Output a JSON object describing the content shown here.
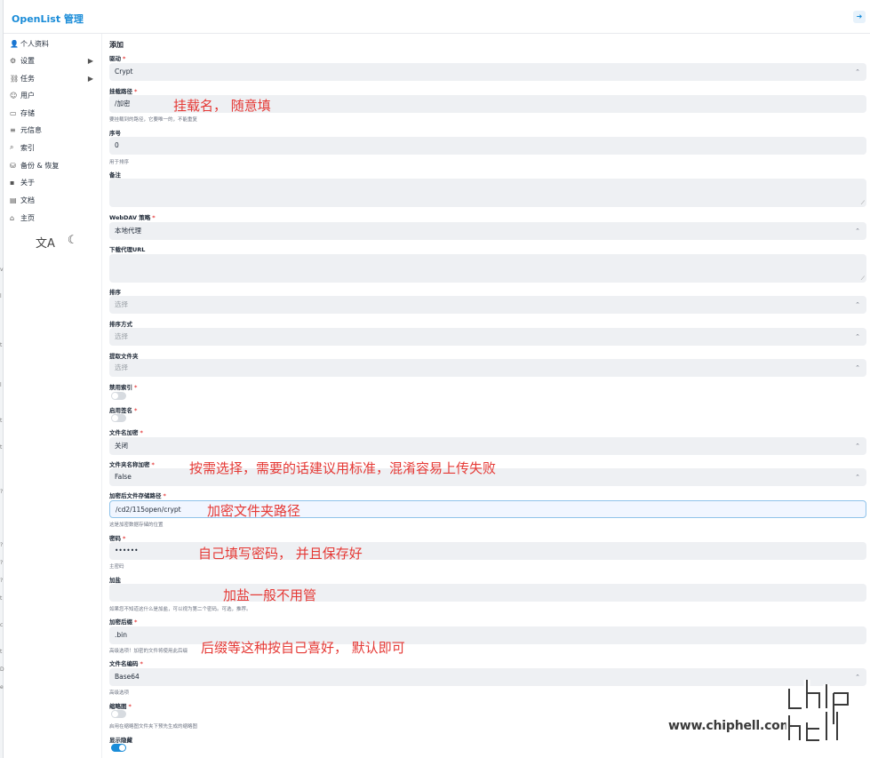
{
  "header": {
    "brand": "OpenList 管理"
  },
  "sidebar": {
    "items": [
      {
        "label": "个人资料",
        "icon": "user-circle-icon",
        "glyph": "👤"
      },
      {
        "label": "设置",
        "icon": "gear-icon",
        "glyph": "⚙",
        "arrow": "▶"
      },
      {
        "label": "任务",
        "icon": "task-icon",
        "glyph": "⛓",
        "arrow": "▶"
      },
      {
        "label": "用户",
        "icon": "user-icon",
        "glyph": "☺"
      },
      {
        "label": "存储",
        "icon": "storage-icon",
        "glyph": "▭"
      },
      {
        "label": "元信息",
        "icon": "meta-icon",
        "glyph": "≡"
      },
      {
        "label": "索引",
        "icon": "search-icon",
        "glyph": "⌕"
      },
      {
        "label": "备份 & 恢复",
        "icon": "database-icon",
        "glyph": "⛁"
      },
      {
        "label": "关于",
        "icon": "info-icon",
        "glyph": "▪"
      },
      {
        "label": "文档",
        "icon": "book-icon",
        "glyph": "▤"
      },
      {
        "label": "主页",
        "icon": "home-icon",
        "glyph": "⌂"
      }
    ],
    "translate_glyph": "文A",
    "theme_glyph": "☾"
  },
  "form": {
    "title": "添加",
    "driver": {
      "label": "驱动",
      "value": "Crypt"
    },
    "mount_path": {
      "label": "挂载路径",
      "value": "/加密",
      "hint": "要挂载到的路径，它要唯一的，不能重复"
    },
    "order": {
      "label": "序号",
      "value": "0",
      "hint": "用于排序"
    },
    "remark": {
      "label": "备注"
    },
    "webdav": {
      "label": "WebDAV 策略",
      "value": "本地代理"
    },
    "proxy_url": {
      "label": "下载代理URL"
    },
    "sort": {
      "label": "排序",
      "placeholder": "选择"
    },
    "sort_dir": {
      "label": "排序方式",
      "placeholder": "选择"
    },
    "extract_folder": {
      "label": "提取文件夹",
      "placeholder": "选择"
    },
    "disable_index": {
      "label": "禁用索引"
    },
    "enable_sign": {
      "label": "启用签名"
    },
    "filename_enc": {
      "label": "文件名加密",
      "value": "关闭"
    },
    "dirname_enc": {
      "label": "文件夹名称加密",
      "value": "False"
    },
    "remote_path": {
      "label": "加密后文件存储路径",
      "value": "/cd2/115open/crypt",
      "hint": "这是加密数据存储的位置"
    },
    "password": {
      "label": "密码",
      "value": "••••••",
      "hint": "主密码"
    },
    "salt": {
      "label": "加盐",
      "hint": "如果您不知道这什么是加盐，可以视为第二个密码。可选，推荐。"
    },
    "suffix": {
      "label": "加密后缀",
      "value": ".bin",
      "hint": "高级选项！加密的文件将使用此后缀"
    },
    "encoding": {
      "label": "文件名编码",
      "value": "Base64",
      "hint": "高级选项"
    },
    "thumbnail": {
      "label": "缩略图",
      "hint": "启用在缩略图文件夹下预先生成的缩略图"
    },
    "show_hidden": {
      "label": "显示隐藏"
    },
    "required_mark": "*"
  },
  "annotations": {
    "a1": "挂载名， 随意填",
    "a2": "按需选择，需要的话建议用标准，混淆容易上传失败",
    "a3": "加密文件夹路径",
    "a4": "自己填写密码， 并且保存好",
    "a5": "加盐一般不用管",
    "a6": "后缀等这种按自己喜好， 默认即可"
  },
  "watermark": {
    "url": "www.chiphell.com",
    "logo_text": "chiphell"
  },
  "left_edge_fragments": [
    "v",
    "l",
    "t",
    "l",
    "t",
    "t",
    "?",
    "?",
    "?",
    "?",
    "t",
    "c",
    "t",
    "D",
    "e"
  ]
}
